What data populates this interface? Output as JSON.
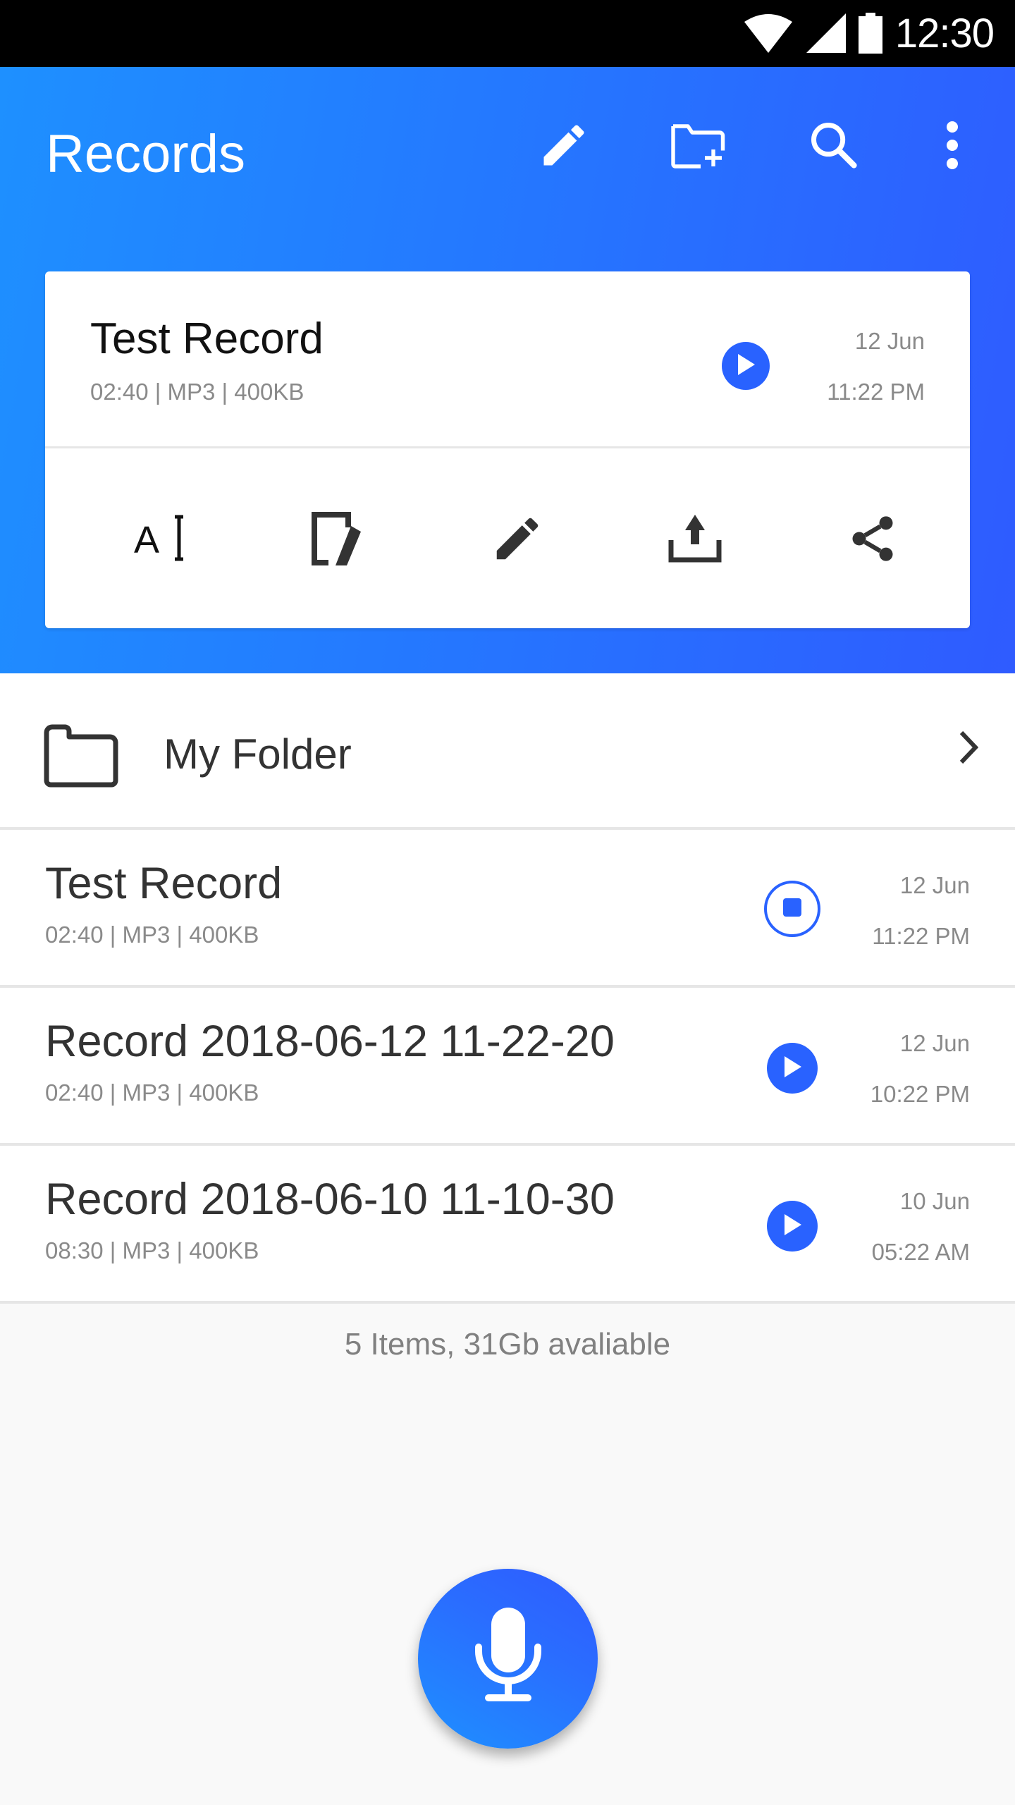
{
  "status_bar": {
    "time": "12:30",
    "icons": [
      "wifi-icon",
      "cellular-signal-icon",
      "battery-icon"
    ]
  },
  "header": {
    "title": "Records",
    "actions": [
      {
        "name": "edit",
        "icon": "pencil-icon"
      },
      {
        "name": "new-folder",
        "icon": "folder-plus-icon"
      },
      {
        "name": "search",
        "icon": "search-icon"
      },
      {
        "name": "more",
        "icon": "more-vertical-icon"
      }
    ]
  },
  "selected_record": {
    "title": "Test Record",
    "meta": "02:40 | MP3 | 400KB",
    "date": "12 Jun",
    "time": "11:22 PM",
    "control": "play",
    "actions": [
      {
        "name": "rename",
        "icon": "text-rename-icon"
      },
      {
        "name": "edit-note",
        "icon": "edit-note-icon"
      },
      {
        "name": "edit",
        "icon": "pencil-icon"
      },
      {
        "name": "upload",
        "icon": "upload-icon"
      },
      {
        "name": "share",
        "icon": "share-icon"
      }
    ]
  },
  "folder": {
    "label": "My Folder"
  },
  "records": [
    {
      "title": "Test Record",
      "meta": "02:40 | MP3 | 400KB",
      "date": "12 Jun",
      "time": "11:22 PM",
      "control": "stop"
    },
    {
      "title": "Record 2018-06-12 11-22-20",
      "meta": "02:40 | MP3 | 400KB",
      "date": "12 Jun",
      "time": "10:22 PM",
      "control": "play"
    },
    {
      "title": "Record 2018-06-10 11-10-30",
      "meta": "08:30 | MP3 | 400KB",
      "date": "10 Jun",
      "time": "05:22 AM",
      "control": "play"
    }
  ],
  "footer": {
    "info": "5 Items, 31Gb avaliable"
  },
  "fab": {
    "icon": "microphone-icon"
  },
  "colors": {
    "accent": "#2962ff",
    "gradient_start": "#1e90ff",
    "gradient_end": "#2f5bff"
  }
}
